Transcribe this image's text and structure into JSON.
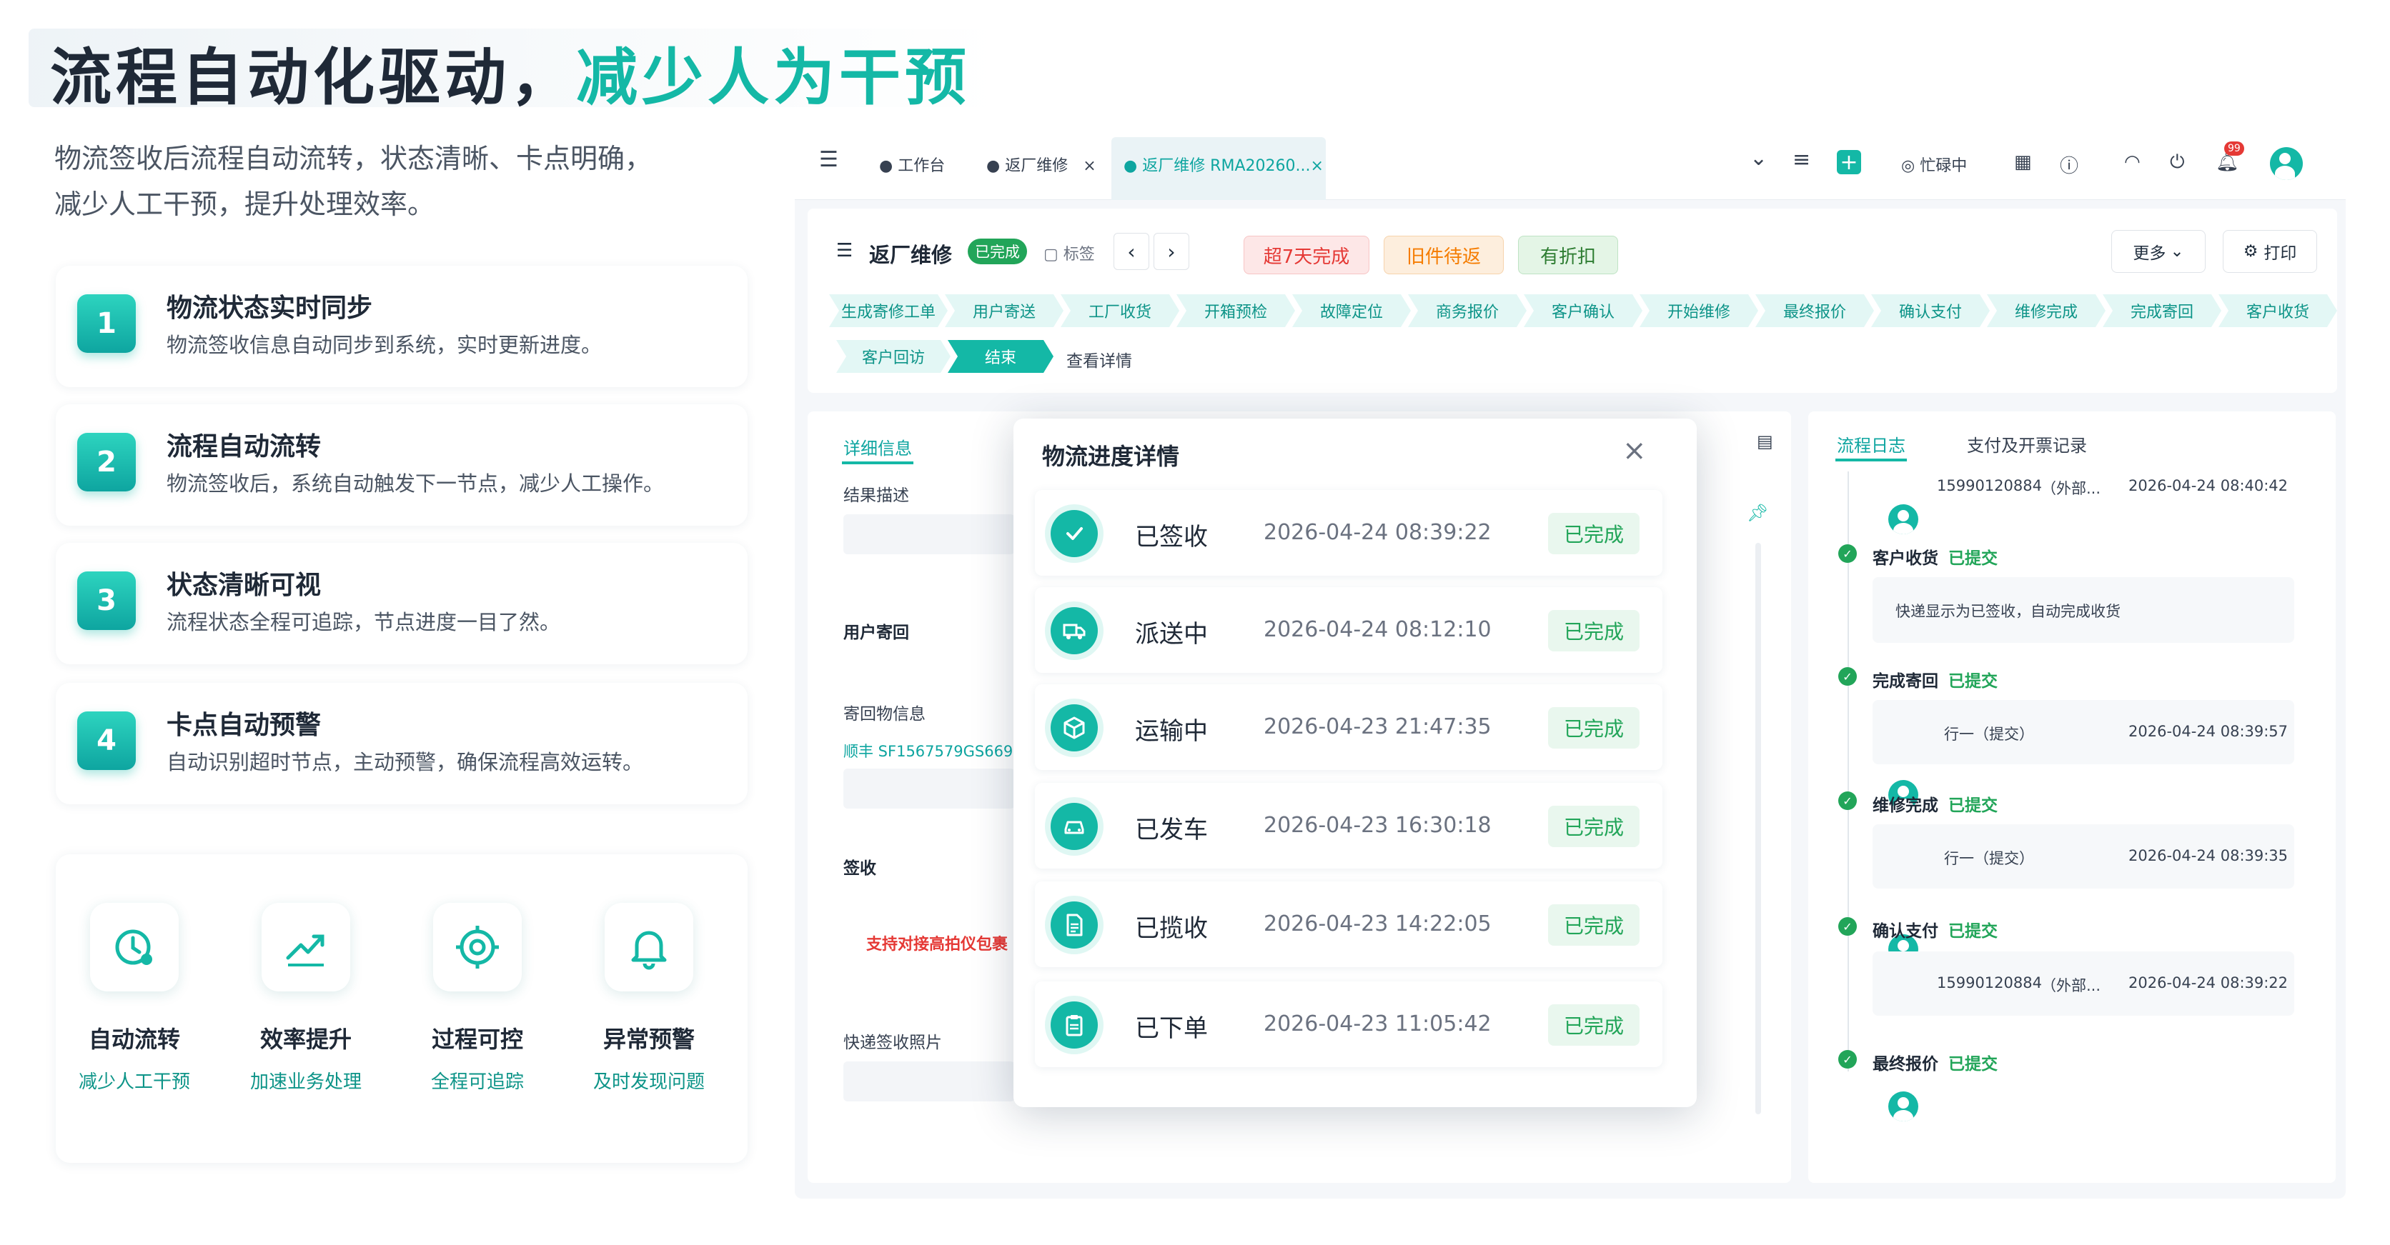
{
  "hero": {
    "title_part1": "流程自动化驱动，",
    "title_part2": "减少人为干预",
    "desc_line1": "物流签收后流程自动流转，状态清晰、卡点明确，",
    "desc_line2": "减少人工干预，提升处理效率。"
  },
  "features": [
    {
      "num": "1",
      "title": "物流状态实时同步",
      "desc": "物流签收信息自动同步到系统，实时更新进度。"
    },
    {
      "num": "2",
      "title": "流程自动流转",
      "desc": "物流签收后，系统自动触发下一节点，减少人工操作。"
    },
    {
      "num": "3",
      "title": "状态清晰可视",
      "desc": "流程状态全程可追踪，节点进度一目了然。"
    },
    {
      "num": "4",
      "title": "卡点自动预警",
      "desc": "自动识别超时节点，主动预警，确保流程高效运转。"
    }
  ],
  "benefits": [
    {
      "title": "自动流转",
      "sub": "减少人工干预",
      "icon": "clock-icon"
    },
    {
      "title": "效率提升",
      "sub": "加速业务处理",
      "icon": "trend-up-icon"
    },
    {
      "title": "过程可控",
      "sub": "全程可追踪",
      "icon": "target-icon"
    },
    {
      "title": "异常预警",
      "sub": "及时发现问题",
      "icon": "bell-icon"
    }
  ],
  "topbar": {
    "tabs": [
      "● 工作台",
      "● 返厂维修",
      "● 返厂维修 RMA20260..."
    ],
    "close_symbol": "×",
    "status_text": "忙碌中",
    "badge_count": "99"
  },
  "header": {
    "title": "返厂维修",
    "status": "已完成",
    "tag_label": "标签",
    "pill_overdue": "超7天完成",
    "pill_old_part": "旧件待返",
    "pill_discount": "有折扣",
    "more_btn": "更多",
    "print_btn": "打印",
    "steps": [
      "生成寄修工单",
      "用户寄送",
      "工厂收货",
      "开箱预检",
      "故障定位",
      "商务报价",
      "客户确认",
      "开始维修",
      "最终报价",
      "确认支付",
      "维修完成",
      "完成寄回",
      "客户收货"
    ],
    "steps_row2": [
      "客户回访",
      "结束"
    ],
    "view_detail": "查看详情"
  },
  "detail": {
    "tab": "详细信息",
    "result_desc": "结果描述",
    "user_return": "用户寄回",
    "return_info": "寄回物信息",
    "tracking": "顺丰 SF1567579GS669",
    "sign": "签收",
    "warning": "支持对接高拍仪包裹",
    "photo": "快递签收照片"
  },
  "modal": {
    "title": "物流进度详情",
    "rows": [
      {
        "name": "已签收",
        "time": "2026-04-24 08:39:22",
        "status": "已完成",
        "icon": "check-icon"
      },
      {
        "name": "派送中",
        "time": "2026-04-24 08:12:10",
        "status": "已完成",
        "icon": "truck-icon"
      },
      {
        "name": "运输中",
        "time": "2026-04-23 21:47:35",
        "status": "已完成",
        "icon": "package-icon"
      },
      {
        "name": "已发车",
        "time": "2026-04-23 16:30:18",
        "status": "已完成",
        "icon": "car-icon"
      },
      {
        "name": "已揽收",
        "time": "2026-04-23 14:22:05",
        "status": "已完成",
        "icon": "document-icon"
      },
      {
        "name": "已下单",
        "time": "2026-04-23 11:05:42",
        "status": "已完成",
        "icon": "clipboard-icon"
      }
    ]
  },
  "log": {
    "tab1": "流程日志",
    "tab2": "支付及开票记录",
    "top_user": "15990120884",
    "top_org": "（外部...",
    "top_time": "2026-04-24 08:40:42",
    "entries": [
      {
        "title": "客户收货",
        "status": "已提交",
        "note": "快递显示为已签收，自动完成收货"
      },
      {
        "title": "完成寄回",
        "status": "已提交",
        "user": "行一（提交）",
        "time": "2026-04-24 08:39:57"
      },
      {
        "title": "维修完成",
        "status": "已提交",
        "user": "行一（提交）",
        "time": "2026-04-24 08:39:35"
      },
      {
        "title": "确认支付",
        "status": "已提交",
        "user": "15990120884",
        "org": "（外部...",
        "time": "2026-04-24 08:39:22"
      },
      {
        "title": "最终报价",
        "status": "已提交"
      }
    ]
  },
  "colors": {
    "accent": "#14b8a6",
    "success": "#22a559",
    "danger": "#e53935",
    "warn": "#f57c00"
  }
}
